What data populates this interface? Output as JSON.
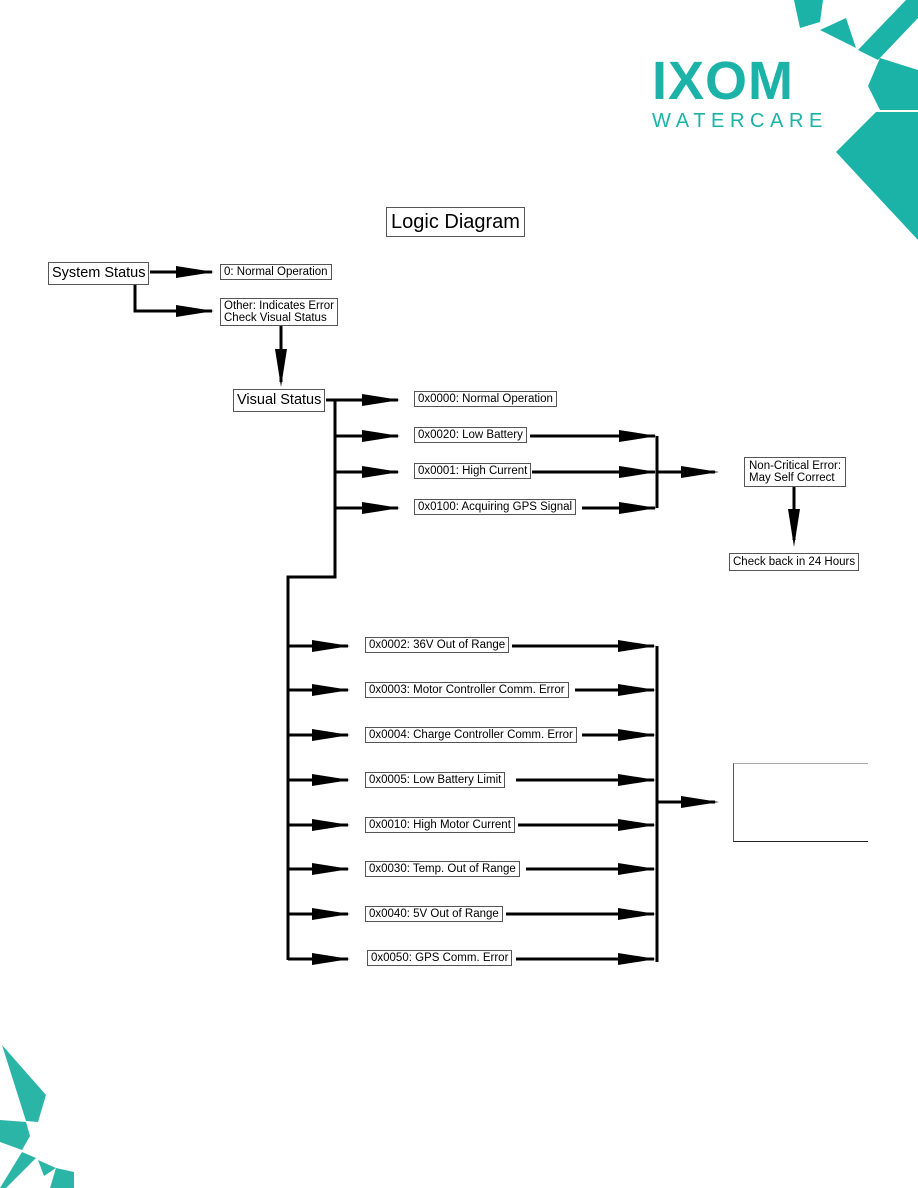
{
  "brand": {
    "name": "IXOM",
    "tagline": "WATERCARE",
    "color": "#1bb3a8"
  },
  "diagram": {
    "title": "Logic Diagram",
    "system_status": {
      "label": "System Status",
      "normal": "0: Normal Operation",
      "other_line1": "Other: Indicates Error",
      "other_line2": "Check Visual Status"
    },
    "visual_status": {
      "label": "Visual Status",
      "normal": "0x0000: Normal Operation",
      "non_critical_codes": [
        "0x0020: Low Battery",
        "0x0001: High Current",
        "0x0100: Acquiring GPS Signal"
      ],
      "non_critical_result_line1": "Non-Critical Error:",
      "non_critical_result_line2": "May Self Correct",
      "non_critical_action": "Check back in 24 Hours",
      "critical_codes": [
        "0x0002: 36V Out of Range",
        "0x0003: Motor Controller Comm. Error",
        "0x0004: Charge Controller Comm. Error",
        "0x0005: Low Battery Limit",
        "0x0010: High Motor Current",
        "0x0030: Temp. Out of Range",
        "0x0040: 5V Out of Range",
        "0x0050: GPS Comm. Error"
      ],
      "critical_result": ""
    }
  }
}
